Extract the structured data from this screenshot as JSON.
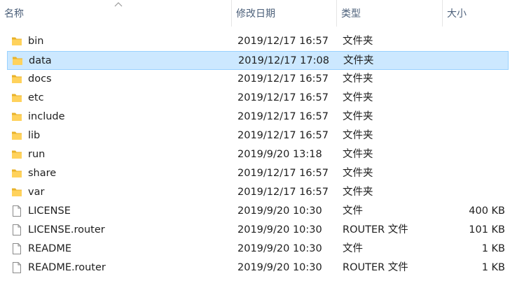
{
  "columns": {
    "name": "名称",
    "modified": "修改日期",
    "type": "类型",
    "size": "大小"
  },
  "selected_index": 1,
  "files": [
    {
      "name": "bin",
      "modified": "2019/12/17 16:57",
      "type": "文件夹",
      "size": "",
      "icon": "folder-icon"
    },
    {
      "name": "data",
      "modified": "2019/12/17 17:08",
      "type": "文件夹",
      "size": "",
      "icon": "folder-icon"
    },
    {
      "name": "docs",
      "modified": "2019/12/17 16:57",
      "type": "文件夹",
      "size": "",
      "icon": "folder-icon"
    },
    {
      "name": "etc",
      "modified": "2019/12/17 16:57",
      "type": "文件夹",
      "size": "",
      "icon": "folder-icon"
    },
    {
      "name": "include",
      "modified": "2019/12/17 16:57",
      "type": "文件夹",
      "size": "",
      "icon": "folder-icon"
    },
    {
      "name": "lib",
      "modified": "2019/12/17 16:57",
      "type": "文件夹",
      "size": "",
      "icon": "folder-icon"
    },
    {
      "name": "run",
      "modified": "2019/9/20 13:18",
      "type": "文件夹",
      "size": "",
      "icon": "folder-icon"
    },
    {
      "name": "share",
      "modified": "2019/12/17 16:57",
      "type": "文件夹",
      "size": "",
      "icon": "folder-icon"
    },
    {
      "name": "var",
      "modified": "2019/12/17 16:57",
      "type": "文件夹",
      "size": "",
      "icon": "folder-icon"
    },
    {
      "name": "LICENSE",
      "modified": "2019/9/20 10:30",
      "type": "文件",
      "size": "400 KB",
      "icon": "file-icon"
    },
    {
      "name": "LICENSE.router",
      "modified": "2019/9/20 10:30",
      "type": "ROUTER 文件",
      "size": "101 KB",
      "icon": "file-icon"
    },
    {
      "name": "README",
      "modified": "2019/9/20 10:30",
      "type": "文件",
      "size": "1 KB",
      "icon": "file-icon"
    },
    {
      "name": "README.router",
      "modified": "2019/9/20 10:30",
      "type": "ROUTER 文件",
      "size": "1 KB",
      "icon": "file-icon"
    }
  ]
}
